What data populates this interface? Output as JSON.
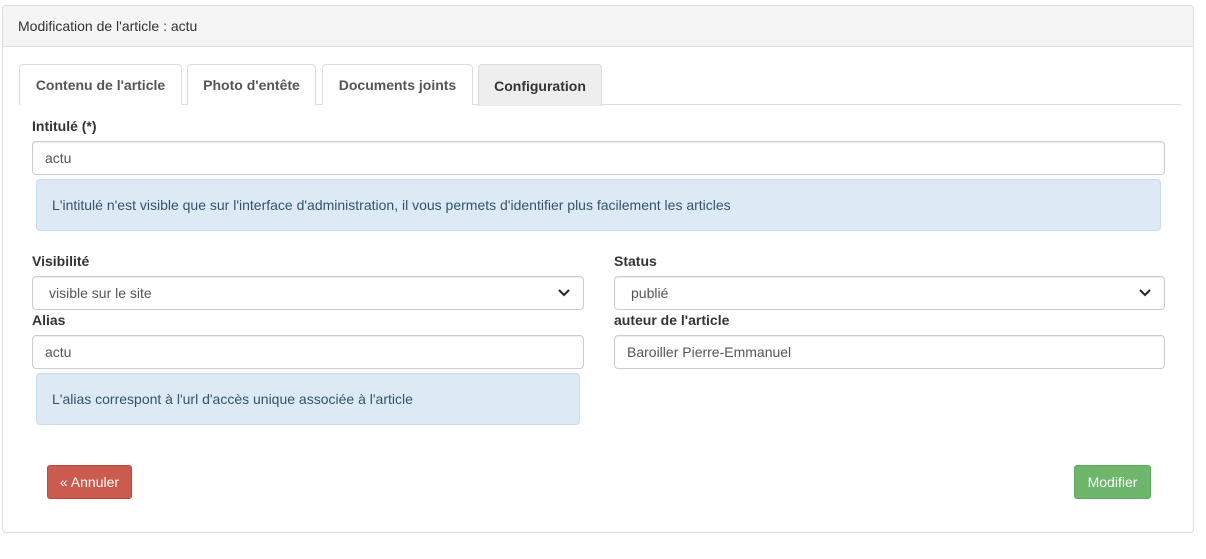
{
  "panel": {
    "title": "Modification de l'article : actu"
  },
  "tabs": [
    {
      "label": "Contenu de l'article",
      "active": false
    },
    {
      "label": "Photo d'entête",
      "active": false
    },
    {
      "label": "Documents joints",
      "active": false
    },
    {
      "label": "Configuration",
      "active": true
    }
  ],
  "form": {
    "intitule": {
      "label": "Intitulé (*)",
      "value": "actu",
      "help": "L'intitulé n'est visible que sur l'interface d'administration, il vous permets d'identifier plus facilement les articles"
    },
    "visibilite": {
      "label": "Visibilité",
      "selected": "visible sur le site"
    },
    "status": {
      "label": "Status",
      "selected": "publié"
    },
    "alias": {
      "label": "Alias",
      "value": "actu",
      "help": "L'alias correspont à l'url d'accès unique associée à l'article"
    },
    "auteur": {
      "label": "auteur de l'article",
      "value": "Baroiller Pierre-Emmanuel"
    }
  },
  "buttons": {
    "cancel": "« Annuler",
    "submit": "Modifier"
  },
  "colors": {
    "danger": "#cc5b4f",
    "success": "#6db66b",
    "info_bg": "#dde9f5"
  },
  "icons": {
    "select_arrow": "chevron-down-icon"
  }
}
